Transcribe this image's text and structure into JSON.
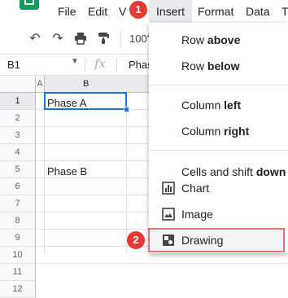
{
  "menu": {
    "items": [
      "File",
      "Edit",
      "V",
      "Insert",
      "Format",
      "Data",
      "T"
    ],
    "active": "Insert"
  },
  "steps": {
    "step1": "1",
    "step2": "2"
  },
  "toolbar": {
    "zoom": "100'"
  },
  "formula_bar": {
    "cell_ref": "B1",
    "fx": "fx",
    "content": "Phas"
  },
  "grid": {
    "columns": [
      "A",
      "B"
    ],
    "rows": [
      "1",
      "2",
      "3",
      "4",
      "5",
      "6",
      "7",
      "8",
      "9",
      "10",
      "11",
      "12"
    ],
    "cells": {
      "B1": "Phase A",
      "B5": "Phase B"
    }
  },
  "insert_menu": {
    "row_above": {
      "pre": "Row ",
      "bold": "above"
    },
    "row_below": {
      "pre": "Row ",
      "bold": "below"
    },
    "column_left": {
      "pre": "Column ",
      "bold": "left"
    },
    "column_right": {
      "pre": "Column ",
      "bold": "right"
    },
    "cells_shift": {
      "pre": "Cells and shift ",
      "bold": "down"
    },
    "chart": "Chart",
    "image": "Image",
    "drawing": "Drawing"
  },
  "colors": {
    "accent": "#1a73e8",
    "badge": "#e53935",
    "sheets_green": "#0f9d58"
  }
}
